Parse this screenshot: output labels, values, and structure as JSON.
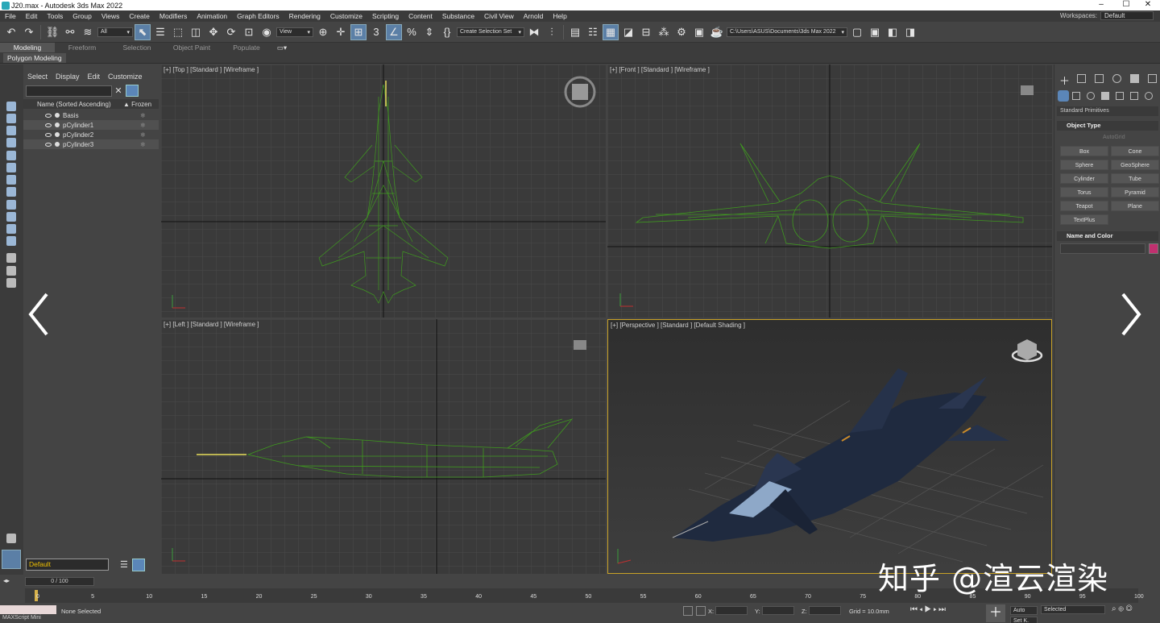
{
  "window": {
    "title": "J20.max - Autodesk 3ds Max 2022",
    "controls": [
      "–",
      "☐",
      "✕"
    ]
  },
  "menu": [
    "File",
    "Edit",
    "Tools",
    "Group",
    "Views",
    "Create",
    "Modifiers",
    "Animation",
    "Graph Editors",
    "Rendering",
    "Customize",
    "Scripting",
    "Content",
    "Substance",
    "Civil View",
    "Arnold",
    "Help"
  ],
  "workspaces": {
    "label": "Workspaces:",
    "value": "Default"
  },
  "toolbar": {
    "filter_value": "All",
    "view_value": "View",
    "selection_set_placeholder": "Create Selection Set",
    "project_path": "C:\\Users\\ASUS\\Documents\\3ds Max 2022"
  },
  "ribbon": {
    "tabs": [
      "Modeling",
      "Freeform",
      "Selection",
      "Object Paint",
      "Populate"
    ],
    "active_tab": "Modeling",
    "sub_label": "Polygon Modeling"
  },
  "explorer": {
    "tabs": [
      "Select",
      "Display",
      "Edit",
      "Customize"
    ],
    "header_name": "Name (Sorted Ascending)",
    "header_frozen": "▲ Frozen",
    "rows": [
      "Basis",
      "pCylinder1",
      "pCylinder2",
      "pCylinder3"
    ],
    "layer_value": "Default"
  },
  "viewports": {
    "top": "[+] [Top ] [Standard ] [Wireframe ]",
    "front": "[+] [Front ] [Standard ] [Wireframe ]",
    "left": "[+] [Left ] [Standard ] [Wireframe ]",
    "perspective": "[+] [Perspective ] [Standard ] [Default Shading ]"
  },
  "command_panel": {
    "category": "Standard Primitives",
    "object_type_title": "Object Type",
    "autogrid": "AutoGrid",
    "primitives": [
      "Box",
      "Cone",
      "Sphere",
      "GeoSphere",
      "Cylinder",
      "Tube",
      "Torus",
      "Pyramid",
      "Teapot",
      "Plane",
      "TextPlus"
    ],
    "name_color_title": "Name and Color",
    "color": "#c0306f"
  },
  "timeline": {
    "frame_readout": "0 / 100",
    "ticks": [
      "0",
      "5",
      "10",
      "15",
      "20",
      "25",
      "30",
      "35",
      "40",
      "45",
      "50",
      "55",
      "60",
      "65",
      "70",
      "75",
      "80",
      "85",
      "90",
      "95",
      "100"
    ]
  },
  "status": {
    "selection": "None Selected",
    "maxscript": "MAXScript Mini",
    "x_label": "X:",
    "y_label": "Y:",
    "z_label": "Z:",
    "grid": "Grid = 10.0mm",
    "auto": "Auto",
    "selected": "Selected",
    "set_k": "Set K."
  },
  "watermark": "知乎 @渲云渲染",
  "colors": {
    "wireframe": "#3f9a1f",
    "accent": "#5b86b8",
    "active_viewport_border": "#c9a227"
  }
}
